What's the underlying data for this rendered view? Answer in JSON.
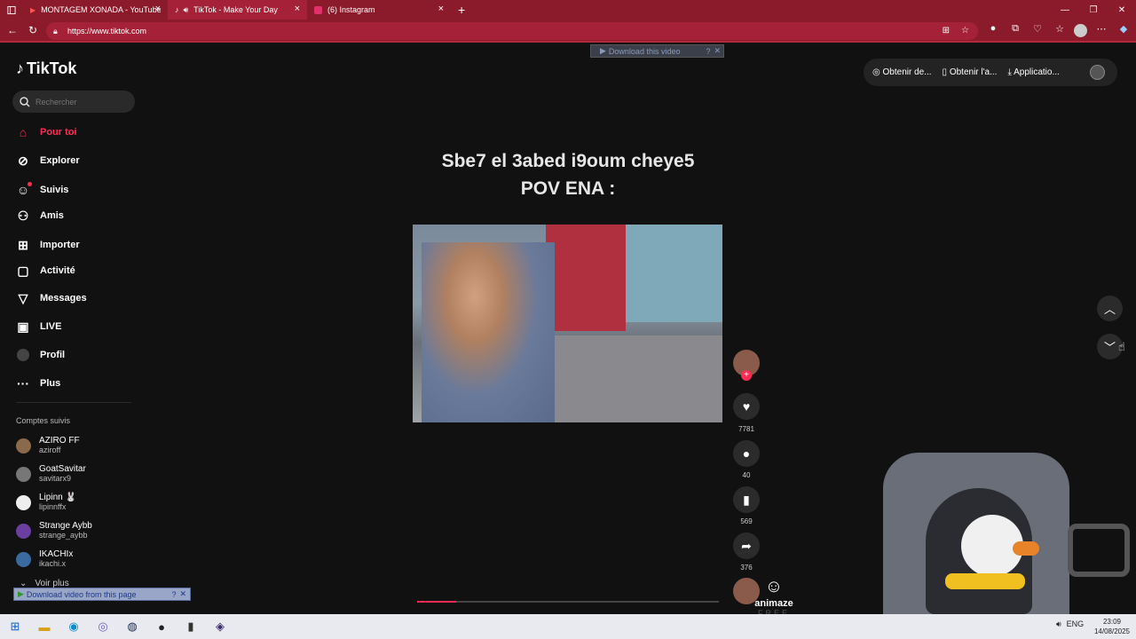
{
  "browser": {
    "tabs": [
      {
        "title": "MONTAGEM XONADA - YouTube"
      },
      {
        "title": "TikTok - Make Your Day"
      },
      {
        "title": "(6) Instagram"
      }
    ],
    "url": "https://www.tiktok.com"
  },
  "tiktok": {
    "logo": "TikTok",
    "search_placeholder": "Rechercher",
    "nav": [
      {
        "label": "Pour toi",
        "icon": "home-icon"
      },
      {
        "label": "Explorer",
        "icon": "compass-icon"
      },
      {
        "label": "Suivis",
        "icon": "following-icon"
      },
      {
        "label": "Amis",
        "icon": "friends-icon"
      },
      {
        "label": "Importer",
        "icon": "upload-icon"
      },
      {
        "label": "Activité",
        "icon": "activity-icon"
      },
      {
        "label": "Messages",
        "icon": "messages-icon"
      },
      {
        "label": "LIVE",
        "icon": "live-icon"
      },
      {
        "label": "Profil",
        "icon": "profile-icon"
      },
      {
        "label": "Plus",
        "icon": "more-icon"
      }
    ],
    "followed_heading": "Comptes suivis",
    "followed": [
      {
        "name": "AZIRO FF",
        "handle": "aziroff"
      },
      {
        "name": "GoatSavitar",
        "handle": "savitarx9"
      },
      {
        "name": "Lipinn 🐰",
        "handle": "lipinnffx"
      },
      {
        "name": "Strange Aybb",
        "handle": "strange_aybb"
      },
      {
        "name": "IKACHIx",
        "handle": "ikachi.x"
      }
    ],
    "see_more": "Voir plus",
    "top_buttons": [
      "Obtenir de...",
      "Obtenir l'a...",
      "Applicatio..."
    ],
    "video_caption_line1": "Sbe7 el 3abed i9oum cheye5",
    "video_caption_line2": "POV ENA :",
    "stats": {
      "likes": "7781",
      "comments": "40",
      "saves": "569",
      "shares": "376"
    },
    "progress": 0.13
  },
  "overlays": {
    "download_video": "Download this video",
    "download_page": "Download video from this page",
    "watermark": "animaze",
    "watermark_sub": "FREE"
  },
  "taskbar": {
    "lang": "ENG",
    "time": "23:09",
    "date": "14/08/2025"
  }
}
